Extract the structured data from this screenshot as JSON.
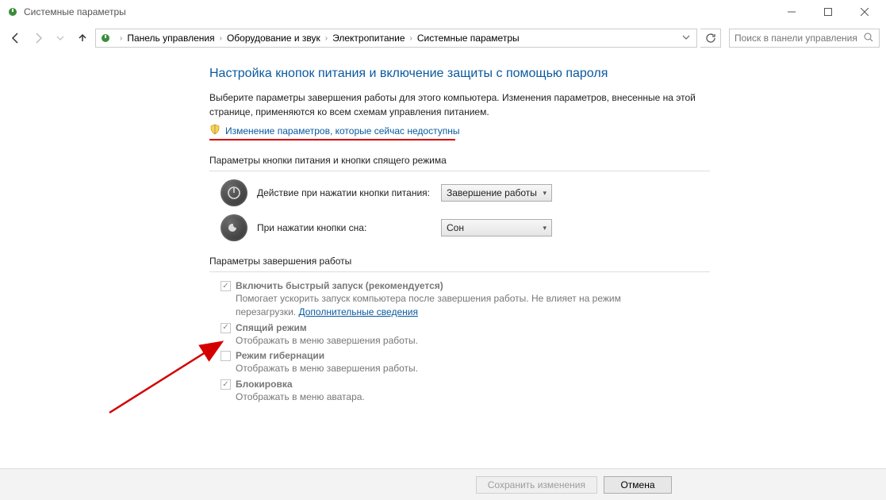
{
  "window": {
    "title": "Системные параметры"
  },
  "breadcrumb": {
    "items": [
      "Панель управления",
      "Оборудование и звук",
      "Электропитание",
      "Системные параметры"
    ]
  },
  "search": {
    "placeholder": "Поиск в панели управления"
  },
  "page": {
    "title": "Настройка кнопок питания и включение защиты с помощью пароля",
    "intro": "Выберите параметры завершения работы для этого компьютера. Изменения параметров, внесенные на этой странице, применяются ко всем схемам управления питанием.",
    "admin_link": "Изменение параметров, которые сейчас недоступны"
  },
  "buttons_section": {
    "header": "Параметры кнопки питания и кнопки спящего режима",
    "power": {
      "label": "Действие при нажатии кнопки питания:",
      "value": "Завершение работы"
    },
    "sleep": {
      "label": "При нажатии кнопки сна:",
      "value": "Сон"
    }
  },
  "shutdown_section": {
    "header": "Параметры завершения работы",
    "fast_startup": {
      "title": "Включить быстрый запуск (рекомендуется)",
      "desc_prefix": "Помогает ускорить запуск компьютера после завершения работы. Не влияет на режим перезагрузки. ",
      "link": "Дополнительные сведения"
    },
    "sleep_mode": {
      "title": "Спящий режим",
      "desc": "Отображать в меню завершения работы."
    },
    "hibernate": {
      "title": "Режим гибернации",
      "desc": "Отображать в меню завершения работы."
    },
    "lock": {
      "title": "Блокировка",
      "desc": "Отображать в меню аватара."
    }
  },
  "footer": {
    "save": "Сохранить изменения",
    "cancel": "Отмена"
  }
}
